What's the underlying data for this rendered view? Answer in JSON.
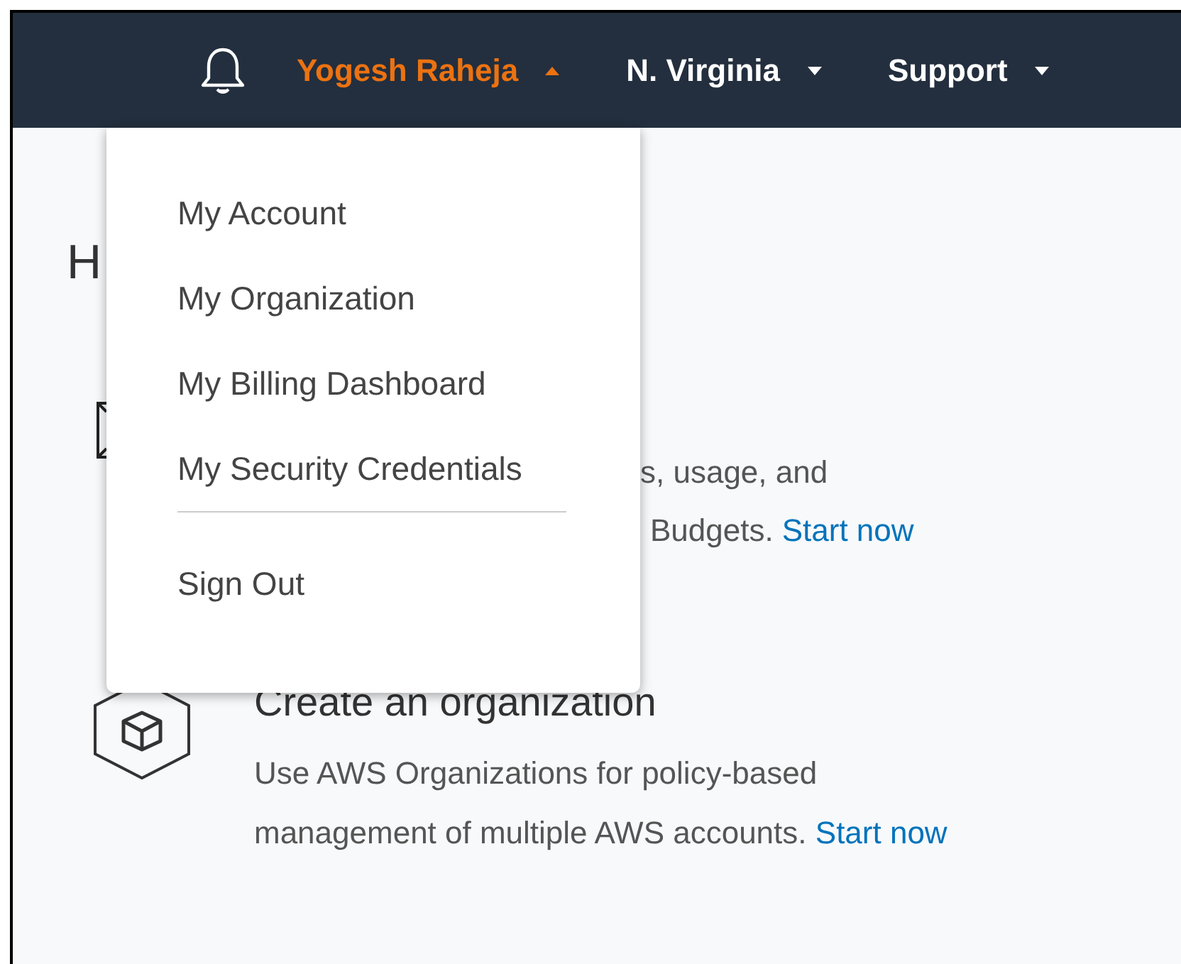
{
  "navbar": {
    "items": [
      {
        "kind": "bell"
      },
      {
        "kind": "menu",
        "label": "Yogesh Raheja",
        "expanded": true
      },
      {
        "kind": "menu",
        "label": "N. Virginia",
        "expanded": false
      },
      {
        "kind": "menu",
        "label": "Support",
        "expanded": false
      }
    ]
  },
  "account_menu": {
    "items": [
      {
        "kind": "item",
        "label": "My Account"
      },
      {
        "kind": "item",
        "label": "My Organization"
      },
      {
        "kind": "item",
        "label": "My Billing Dashboard"
      },
      {
        "kind": "item",
        "label": "My Security Credentials"
      },
      {
        "kind": "divider"
      },
      {
        "kind": "item",
        "label": "Sign Out"
      }
    ]
  },
  "background": {
    "heading_fragment": "H",
    "budget_fragments": [
      "s, usage, and",
      "Budgets."
    ],
    "budget_link": "Start now"
  },
  "organization_card": {
    "title": "Create an organization",
    "text": "Use AWS Organizations for policy-based management of multiple AWS accounts.",
    "link": "Start now"
  }
}
